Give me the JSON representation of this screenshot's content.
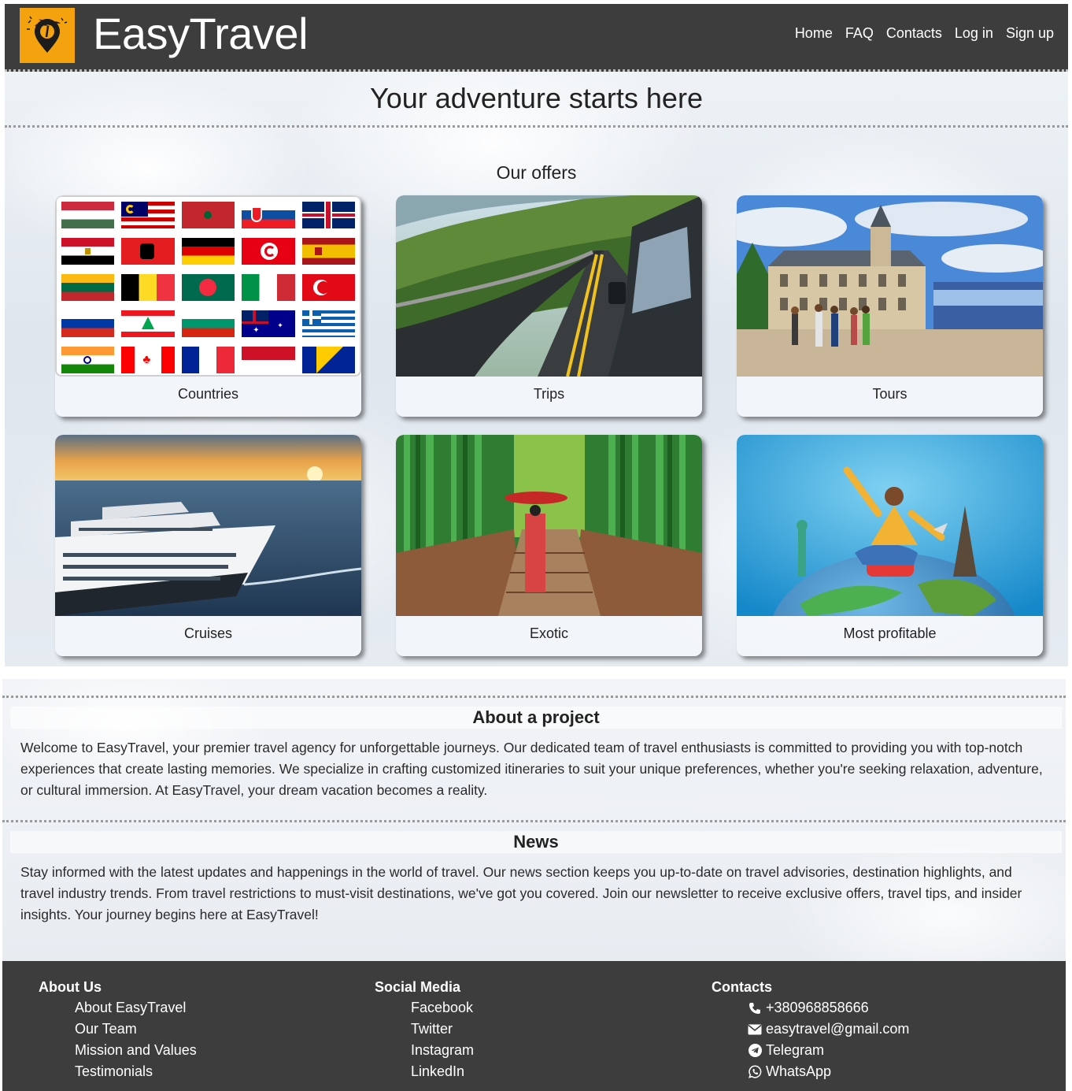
{
  "header": {
    "brand": "EasyTravel",
    "logo_icon": "palm-tree-location-pin-icon",
    "brand_color": "#f5a20f",
    "nav": [
      "Home",
      "FAQ",
      "Contacts",
      "Log in",
      "Sign up"
    ]
  },
  "hero": {
    "tagline": "Your adventure starts here",
    "offers_title": "Our offers"
  },
  "offers": [
    {
      "label": "Countries",
      "image": "world-flags"
    },
    {
      "label": "Trips",
      "image": "mountain-road-car"
    },
    {
      "label": "Tours",
      "image": "city-hall-tourists"
    },
    {
      "label": "Cruises",
      "image": "cruise-ship-sunset"
    },
    {
      "label": "Exotic",
      "image": "bamboo-forest-kimono"
    },
    {
      "label": "Most profitable",
      "image": "traveler-on-globe"
    }
  ],
  "about": {
    "title": "About a project",
    "body": "Welcome to EasyTravel, your premier travel agency for unforgettable journeys. Our dedicated team of travel enthusiasts is committed to providing you with top-notch experiences that create lasting memories. We specialize in crafting customized itineraries to suit your unique preferences, whether you're seeking relaxation, adventure, or cultural immersion. At EasyTravel, your dream vacation becomes a reality."
  },
  "news": {
    "title": "News",
    "body": "Stay informed with the latest updates and happenings in the world of travel. Our news section keeps you up-to-date on travel advisories, destination highlights, and travel industry trends. From travel restrictions to must-visit destinations, we've got you covered. Join our newsletter to receive exclusive offers, travel tips, and insider insights. Your journey begins here at EasyTravel!"
  },
  "footer": {
    "about_us": {
      "title": "About Us",
      "links": [
        "About EasyTravel",
        "Our Team",
        "Mission and Values",
        "Testimonials"
      ]
    },
    "social": {
      "title": "Social Media",
      "links": [
        "Facebook",
        "Twitter",
        "Instagram",
        "LinkedIn"
      ]
    },
    "contacts": {
      "title": "Contacts",
      "items": [
        {
          "icon": "phone-icon",
          "text": "+380968858666"
        },
        {
          "icon": "envelope-icon",
          "text": "easytravel@gmail.com"
        },
        {
          "icon": "telegram-icon",
          "text": "Telegram"
        },
        {
          "icon": "whatsapp-icon",
          "text": "WhatsApp"
        }
      ]
    }
  }
}
